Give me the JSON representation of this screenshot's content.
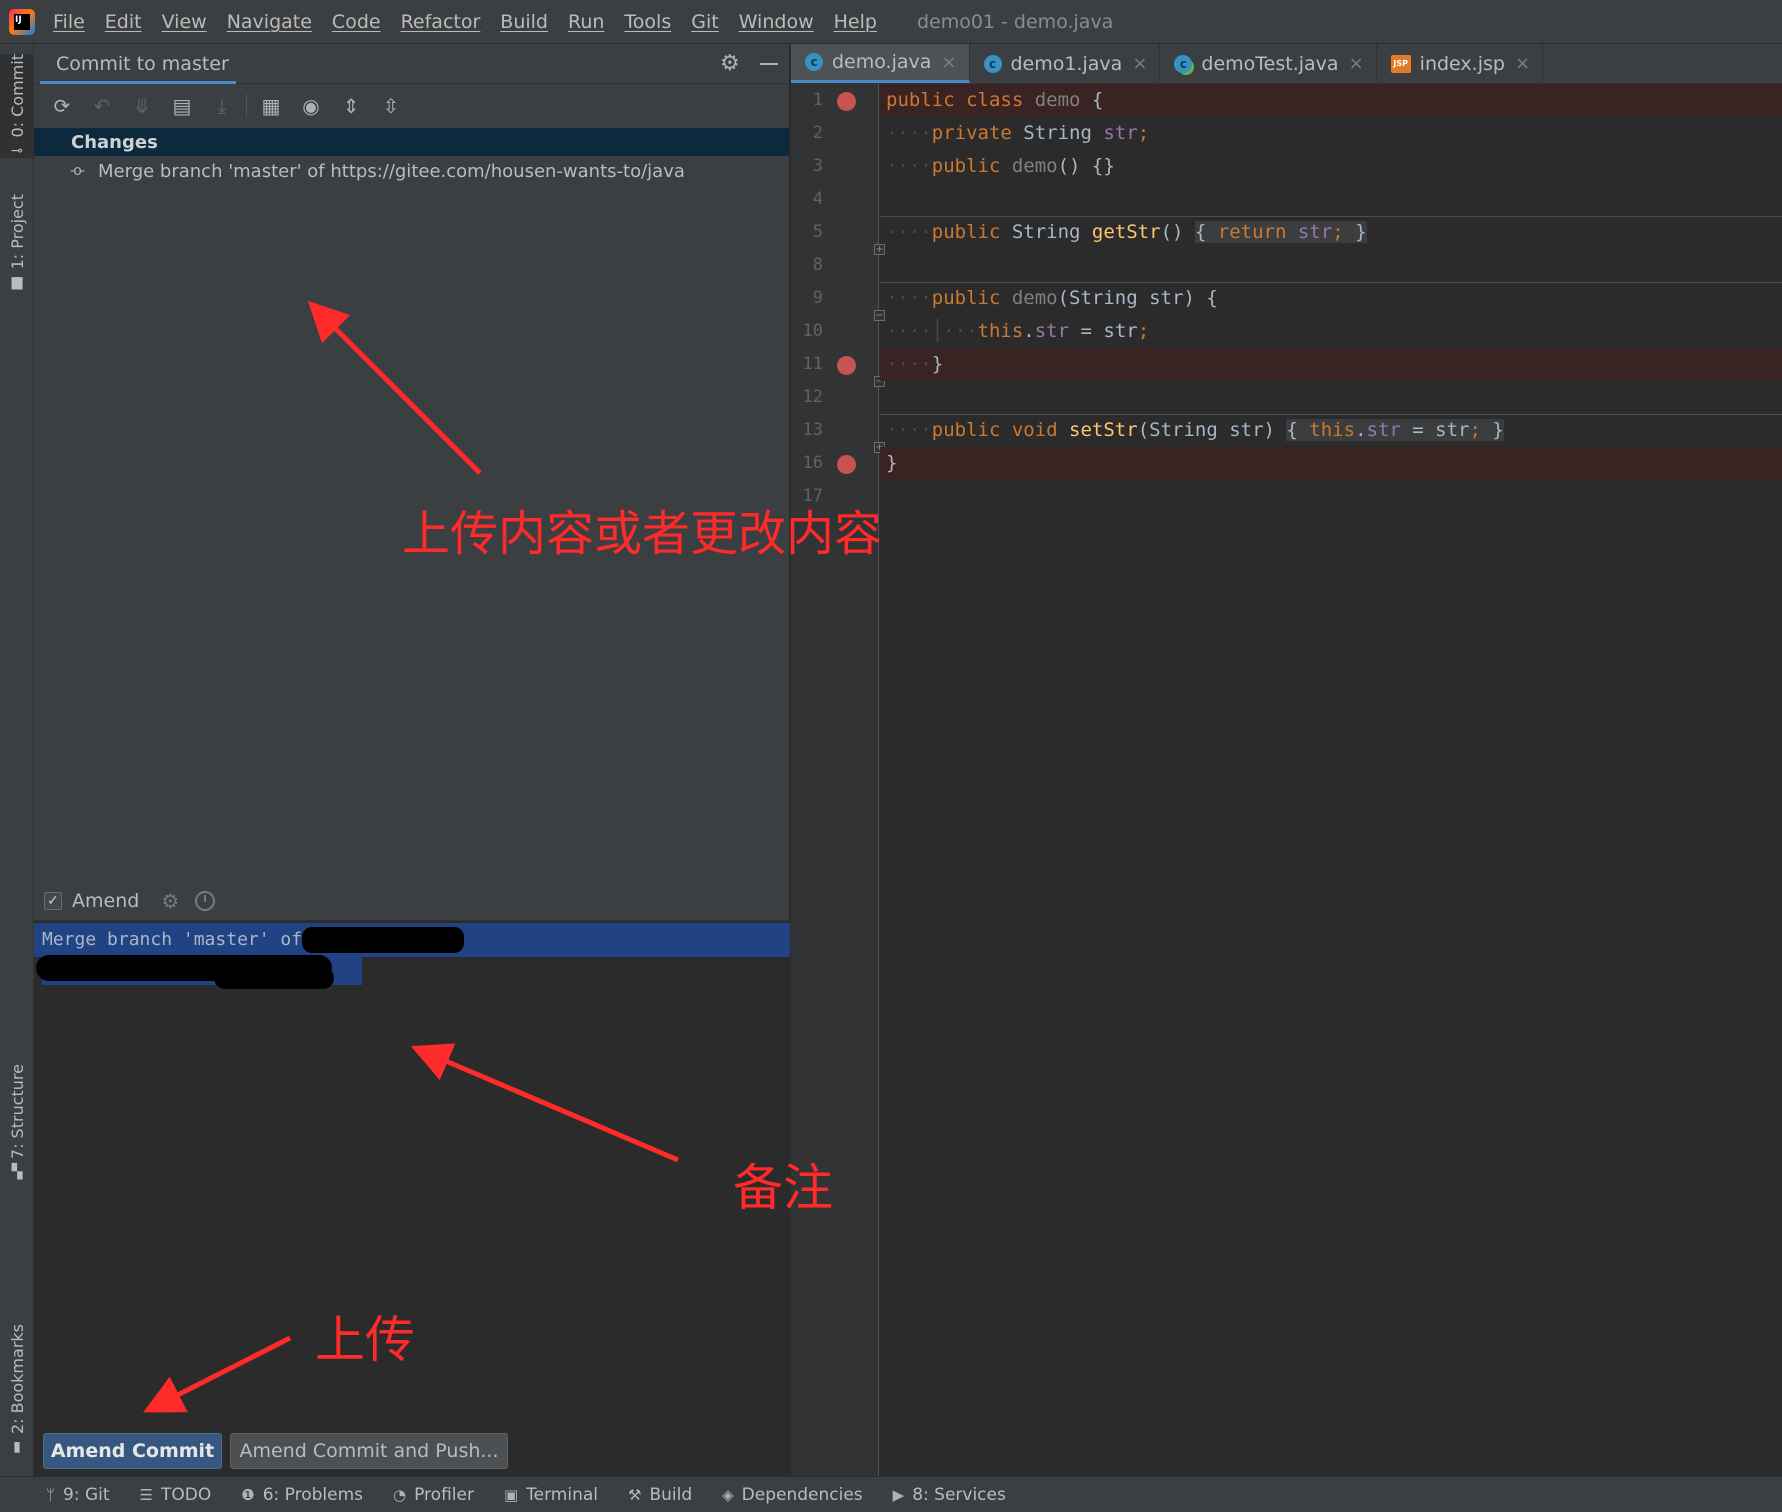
{
  "menubar": {
    "items": [
      "File",
      "Edit",
      "View",
      "Navigate",
      "Code",
      "Refactor",
      "Build",
      "Run",
      "Tools",
      "Git",
      "Window",
      "Help"
    ],
    "window_title": "demo01 - demo.java"
  },
  "left_stripe": {
    "commit": "0: Commit",
    "project": "1: Project",
    "structure": "7: Structure",
    "bookmarks": "2: Bookmarks"
  },
  "commit_panel": {
    "title": "Commit to master",
    "changes_header": "Changes",
    "merge_entry": "Merge branch 'master' of https://gitee.com/housen-wants-to/java",
    "amend_label": "Amend",
    "amend_checked": true,
    "message": "Merge branch 'master' of ",
    "amend_commit_button": "Amend Commit",
    "amend_push_button": "Amend Commit and Push..."
  },
  "editor": {
    "tabs": [
      {
        "label": "demo.java",
        "icon": "class-icon",
        "active": true
      },
      {
        "label": "demo1.java",
        "icon": "class-icon",
        "active": false
      },
      {
        "label": "demoTest.java",
        "icon": "test-class-icon",
        "active": false
      },
      {
        "label": "index.jsp",
        "icon": "jsp-icon",
        "active": false
      }
    ],
    "line_numbers": [
      "1",
      "2",
      "3",
      "4",
      "5",
      "8",
      "9",
      "10",
      "11",
      "12",
      "13",
      "16",
      "17"
    ],
    "breakpoint_lines": [
      "1",
      "11",
      "16"
    ]
  },
  "bottom_bar": {
    "tabs": [
      "9: Git",
      "TODO",
      "6: Problems",
      "Profiler",
      "Terminal",
      "Build",
      "Dependencies",
      "8: Services"
    ]
  },
  "annotations": {
    "upload_content": "上传内容或者更改内容",
    "remark": "备注",
    "upload": "上传"
  },
  "colors": {
    "annotation_red": "#ff2a2a",
    "selection_blue": "#214283",
    "primary_button": "#365880",
    "breakpoint": "#c75450"
  }
}
